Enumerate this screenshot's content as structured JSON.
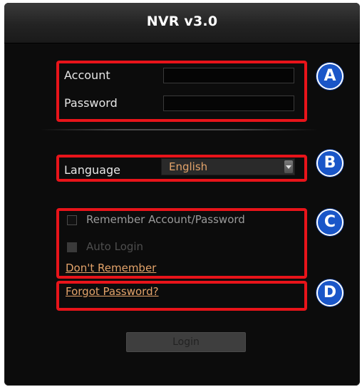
{
  "window": {
    "title": "NVR v3.0"
  },
  "credentials": {
    "account_label": "Account",
    "account_value": "",
    "password_label": "Password",
    "password_value": ""
  },
  "language": {
    "label": "Language",
    "selected": "English"
  },
  "options": {
    "remember_label": "Remember Account/Password",
    "remember_checked": false,
    "auto_login_label": "Auto Login",
    "auto_login_enabled": false,
    "dont_remember_link": "Don't Remember"
  },
  "forgot_password_link": "Forgot Password?",
  "login_button": {
    "label": "Login",
    "enabled": false
  },
  "callouts": [
    "A",
    "B",
    "C",
    "D"
  ],
  "colors": {
    "background": "#0c0c0c",
    "accent_text": "#e3a36a",
    "highlight": "#e8141a",
    "badge": "#1a56c8"
  }
}
